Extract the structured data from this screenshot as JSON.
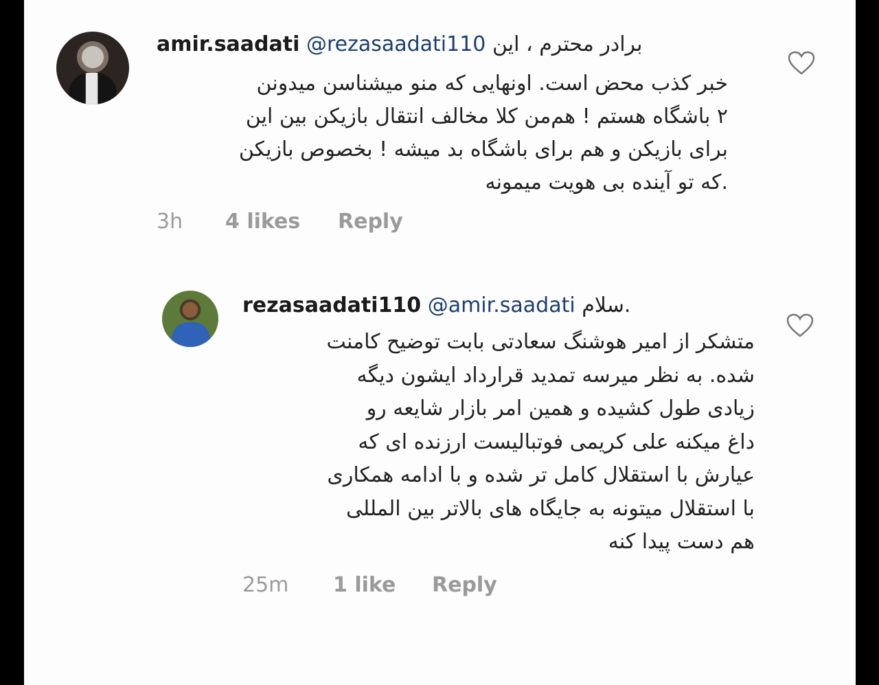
{
  "comments": [
    {
      "username": "amir.saadati",
      "mention": "@rezasaadati110",
      "first_line_text": "برادر محترم ، این",
      "lines": [
        "خبر کذب محض است.  اونهایی که منو میشناسن میدونن",
        "۲ باشگاه هستم ! هم‌من کلا مخالف انتقال بازیکن بین این",
        "برای بازیکن و هم برای باشگاه بد میشه ! بخصوص بازیکن",
        ".که تو آینده بی هویت میمونه"
      ],
      "time": "3h",
      "likes": "4 likes",
      "reply": "Reply",
      "avatar_icon": "profile-photo",
      "like_icon": "heart-outline-icon"
    },
    {
      "username": "rezasaadati110",
      "mention": "@amir.saadati",
      "first_line_text": ".سلام",
      "lines": [
        "متشکر از امیر هوشنگ سعادتی بابت توضیح کامنت",
        "شده. به نظر میرسه تمدید قرارداد ایشون دیگه",
        "زیادی طول کشیده و همین امر بازار شایعه رو",
        "داغ میکنه علی کریمی فوتبالیست ارزنده ای که",
        "عیارش با استقلال کامل تر شده و با ادامه همکاری",
        "با استقلال میتونه به جایگاه های بالاتر بین المللی",
        "هم دست پیدا کنه"
      ],
      "time": "25m",
      "likes": "1 like",
      "reply": "Reply",
      "avatar_icon": "profile-photo",
      "like_icon": "heart-outline-icon"
    }
  ],
  "colors": {
    "background": "#fdfdfd",
    "frame": "#000000",
    "text": "#222222",
    "mention": "#1d3f6d",
    "meta": "#9a9a9a"
  }
}
